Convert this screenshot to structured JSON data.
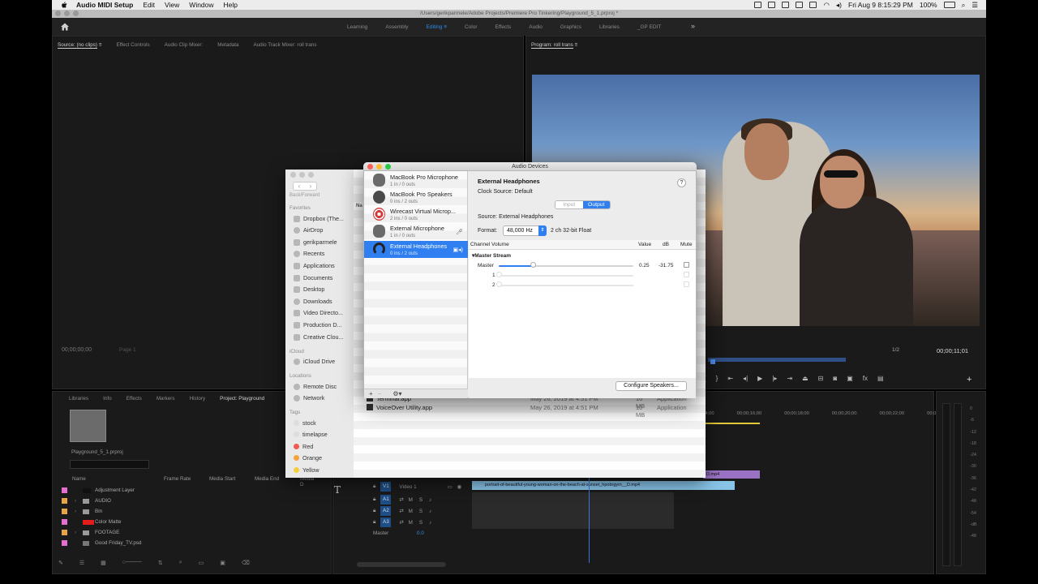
{
  "menubar": {
    "app": "Audio MIDI Setup",
    "items": [
      "Edit",
      "View",
      "Window",
      "Help"
    ],
    "clock": "Fri Aug 9  8:15:29 PM",
    "battery": "100%"
  },
  "premiere": {
    "title_path": "/Users/gerikparmele/Adobe Projects/Premiere Pro Tinkering/Playground_5_1.prproj *",
    "workspaces": [
      "Learning",
      "Assembly",
      "Editing",
      "Color",
      "Effects",
      "Audio",
      "Graphics",
      "Libraries",
      "_GP EDIT"
    ],
    "active_workspace": "Editing",
    "source_tabs": [
      "Source: (no clips)",
      "Effect Controls",
      "Audio Clip Mixer:",
      "Metadata",
      "Audio Track Mixer: roll trans"
    ],
    "source_timecode": "00;00;00;00",
    "source_page": "Page 1",
    "program_title": "Program: roll trans",
    "program_zoom": "1/2",
    "program_timecode": "00;00;11;01",
    "project_tabs": [
      "Libraries",
      "Info",
      "Effects",
      "Markers",
      "History",
      "Project: Playground"
    ],
    "project_file": "Playground_5_1.prproj",
    "project_columns": [
      "Name",
      "Frame Rate",
      "Media Start",
      "Media End",
      "Media D"
    ],
    "project_items": [
      {
        "name": "Adjustment Layer",
        "color": "#e46fd0"
      },
      {
        "name": "AUDIO",
        "color": "#e7a34a"
      },
      {
        "name": "Bin",
        "color": "#e7a34a"
      },
      {
        "name": "Color Matte",
        "color": "#e46fd0"
      },
      {
        "name": "FOOTAGE",
        "color": "#e7a34a"
      },
      {
        "name": "Good Friday_TV.psd",
        "color": "#e46fd0"
      }
    ],
    "ruler": [
      "00;00;14;00",
      "00;00;16;00",
      "00;00;18;00",
      "00;00;20;00",
      "00;00;22;00",
      "00;00;24;00"
    ],
    "tracks": {
      "video": "Video 1",
      "v_label": "V1",
      "audio": [
        "A1",
        "A2",
        "A3"
      ],
      "master": "Master",
      "master_value": "0.0"
    },
    "clip_purple": "D.mp4",
    "clip_v1": "portrait-of-beautiful-young-woman-on-the-beach-at-sunset_hpobrgym__D.mp4",
    "meter_scale": [
      "0",
      "-6",
      "-12",
      "-18",
      "-24",
      "-30",
      "-36",
      "-42",
      "-48",
      "-54",
      "-dB",
      "-48"
    ]
  },
  "finder": {
    "back_forward": "Back/Forward",
    "column_name": "Na",
    "sections": {
      "favorites": "Favorites",
      "icloud": "iCloud",
      "locations": "Locations",
      "tags": "Tags"
    },
    "favorites": [
      "Dropbox (The...",
      "AirDrop",
      "gerikparmele",
      "Recents",
      "Applications",
      "Documents",
      "Desktop",
      "Downloads",
      "Video Directo...",
      "Production D...",
      "Creative Clou..."
    ],
    "icloud": [
      "iCloud Drive"
    ],
    "locations": [
      "Remote Disc",
      "Network"
    ],
    "tags": [
      {
        "name": "stock",
        "color": "#dddddd"
      },
      {
        "name": "timelapse",
        "color": "#dddddd"
      },
      {
        "name": "Red",
        "color": "#f05a4f"
      },
      {
        "name": "Orange",
        "color": "#f4a23b"
      },
      {
        "name": "Yellow",
        "color": "#f5cf3b"
      }
    ],
    "files": [
      {
        "name": "Terminal.app",
        "date": "May 26, 2019 at 4:51 PM",
        "size": "10 MB",
        "kind": "Application"
      },
      {
        "name": "VoiceOver Utility.app",
        "date": "May 26, 2019 at 4:51 PM",
        "size": "10 MB",
        "kind": "Application"
      }
    ]
  },
  "audio_devices": {
    "window_title": "Audio Devices",
    "devices": [
      {
        "name": "MacBook Pro Microphone",
        "io": "1 in / 0 outs",
        "icon": "microphone-icon",
        "color": "#6a6a6a"
      },
      {
        "name": "MacBook Pro Speakers",
        "io": "0 ins / 2 outs",
        "icon": "speaker-icon",
        "color": "#4a4a4a"
      },
      {
        "name": "Wirecast Virtual Microp...",
        "io": "2 ins / 0 outs",
        "icon": "target-icon",
        "color": "#d23a3a"
      },
      {
        "name": "External Microphone",
        "io": "1 in / 0 outs",
        "icon": "microphone-icon",
        "color": "#6a6a6a"
      },
      {
        "name": "External Headphones",
        "io": "0 ins / 2 outs",
        "icon": "headphones-icon",
        "color": "#222222"
      }
    ],
    "selected": "External Headphones",
    "toolbar": {
      "add": "+",
      "remove": "−",
      "gear": "⚙▾"
    },
    "detail": {
      "name": "External Headphones",
      "clock_source": "Clock Source:  Default",
      "segments": [
        "Input",
        "Output"
      ],
      "active_segment": "Output",
      "source_line": "Source:  External Headphones",
      "format_label": "Format:",
      "format_rate": "48,000 Hz",
      "format_extra": "2 ch 32-bit Float",
      "columns": {
        "channel": "Channel Volume",
        "value": "Value",
        "db": "dB",
        "mute": "Mute"
      },
      "stream": "Master Stream",
      "channels": [
        {
          "label": "Master",
          "value": "0.25",
          "db": "-31.75",
          "level": 0.25
        },
        {
          "label": "1",
          "value": "",
          "db": "",
          "level": 0
        },
        {
          "label": "2",
          "value": "",
          "db": "",
          "level": 0
        }
      ],
      "configure_button": "Configure Speakers..."
    }
  }
}
